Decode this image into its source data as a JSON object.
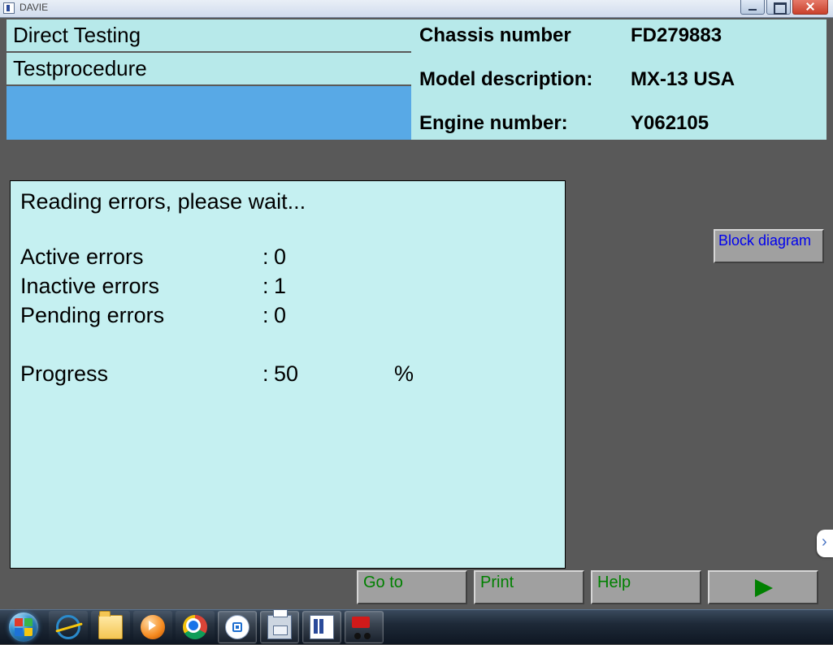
{
  "app": {
    "name": "DAVIE"
  },
  "header": {
    "left": {
      "line1": "Direct Testing",
      "line2": "Testprocedure"
    },
    "right": {
      "chassis_label": "Chassis number",
      "chassis_value": "FD279883",
      "model_label": "Model description:",
      "model_value": "MX-13 USA",
      "engine_label": "Engine number:",
      "engine_value": "Y062105"
    }
  },
  "reading": {
    "message": "Reading errors, please wait...",
    "rows": {
      "active": {
        "label": "Active errors",
        "value": "0"
      },
      "inactive": {
        "label": "Inactive errors",
        "value": "1"
      },
      "pending": {
        "label": "Pending errors",
        "value": "0"
      },
      "progress": {
        "label": "Progress",
        "value": "50",
        "unit": "%"
      }
    }
  },
  "buttons": {
    "block_diagram": "Block diagram",
    "goto": "Go to",
    "print": "Print",
    "help": "Help"
  }
}
